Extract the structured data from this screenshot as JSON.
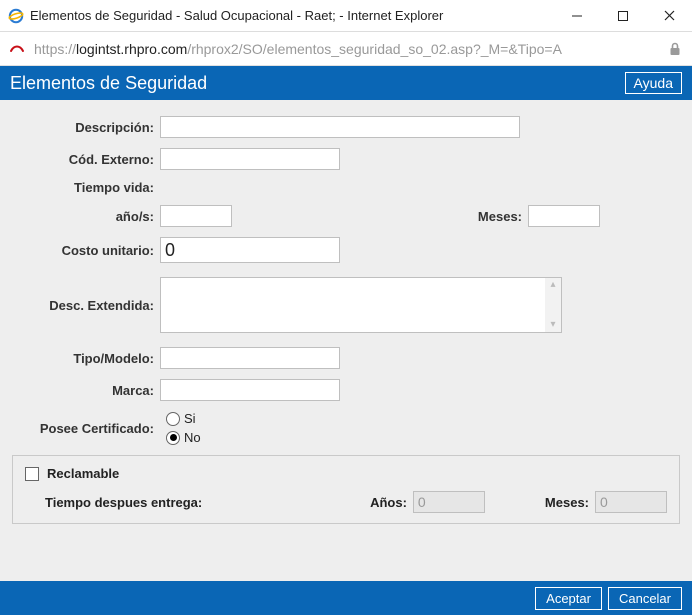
{
  "window": {
    "title": "Elementos de Seguridad - Salud Ocupacional - Raet; - Internet Explorer"
  },
  "address": {
    "scheme": "https://",
    "host": "logintst.rhpro.com",
    "path": "/rhprox2/SO/elementos_seguridad_so_02.asp?_M=&Tipo=A"
  },
  "header": {
    "title": "Elementos de Seguridad",
    "help": "Ayuda"
  },
  "form": {
    "descripcion_label": "Descripción:",
    "descripcion_value": "",
    "cod_externo_label": "Cód. Externo:",
    "cod_externo_value": "",
    "tiempo_vida_label": "Tiempo vida:",
    "anos_label": "año/s:",
    "anos_value": "",
    "meses_label": "Meses:",
    "meses_value": "",
    "costo_label": "Costo unitario:",
    "costo_value": "0",
    "desc_ext_label": "Desc. Extendida:",
    "desc_ext_value": "",
    "tipo_label": "Tipo/Modelo:",
    "tipo_value": "",
    "marca_label": "Marca:",
    "marca_value": "",
    "cert_label": "Posee Certificado:",
    "cert_si": "Si",
    "cert_no": "No",
    "cert_selected": "No"
  },
  "subpanel": {
    "reclamable_label": "Reclamable",
    "reclamable_checked": false,
    "tiempo_label": "Tiempo despues entrega:",
    "anos_label": "Años:",
    "anos_value": "0",
    "meses_label": "Meses:",
    "meses_value": "0"
  },
  "footer": {
    "accept": "Aceptar",
    "cancel": "Cancelar"
  }
}
